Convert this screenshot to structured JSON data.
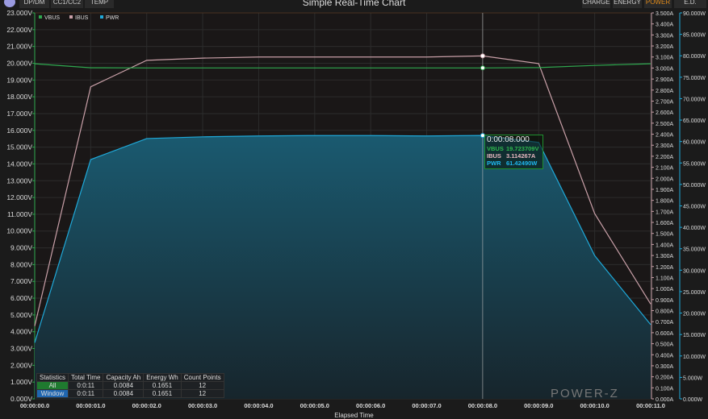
{
  "window": {
    "title": "Simple Real-Time Chart"
  },
  "tabs_left": [
    "DP/DM",
    "CC1/CC2",
    "TEMP"
  ],
  "tabs_right": [
    "CHARGE",
    "ENERGY",
    "POWER",
    "E.D."
  ],
  "active_tab": "POWER",
  "colors": {
    "vbus": "#2fa84f",
    "ibus": "#c9a0a8",
    "pwr": "#1fa8d8",
    "active_tab": "#e08a1a"
  },
  "legend": [
    "VBUS",
    "IBUS",
    "PWR"
  ],
  "tooltip": {
    "time": "0:00:08.000",
    "vbus_label": "VBUS",
    "vbus": "19.723709V",
    "ibus_label": "IBUS",
    "ibus": "3.114267A",
    "pwr_label": "PWR",
    "pwr": "61.42490W"
  },
  "stats": {
    "headers": [
      "Statistics",
      "Total Time",
      "Capacity Ah",
      "Energy Wh",
      "Count Points"
    ],
    "rows": [
      [
        "All",
        "0:0:11",
        "0.0084",
        "0.1651",
        "12"
      ],
      [
        "Window",
        "0:0:11",
        "0.0084",
        "0.1651",
        "12"
      ]
    ]
  },
  "watermark": "POWER-Z",
  "chart_data": {
    "type": "line",
    "title": "Simple Real-Time Chart",
    "xlabel": "Elapsed Time",
    "x": [
      0,
      1,
      2,
      3,
      4,
      5,
      6,
      7,
      8,
      9,
      10,
      11
    ],
    "xticks": [
      "00:00:00.0",
      "00:00:01.0",
      "00:00:02.0",
      "00:00:03.0",
      "00:00:04.0",
      "00:00:05.0",
      "00:00:06.0",
      "00:00:07.0",
      "00:00:08.0",
      "00:00:09.0",
      "00:00:10.0",
      "00:00:11.0"
    ],
    "axes": {
      "vbus": {
        "ylim": [
          0,
          23
        ],
        "unit": "V",
        "step": 1
      },
      "ibus": {
        "ylim": [
          0,
          3.5
        ],
        "unit": "A",
        "step": 0.1
      },
      "pwr": {
        "ylim": [
          0,
          90
        ],
        "unit": "W",
        "step": 5
      }
    },
    "series": [
      {
        "name": "VBUS",
        "axis": "vbus",
        "values": [
          19.97,
          19.73,
          19.72,
          19.72,
          19.72,
          19.72,
          19.72,
          19.72,
          19.72,
          19.74,
          19.87,
          19.97
        ]
      },
      {
        "name": "IBUS",
        "axis": "ibus",
        "values": [
          0.66,
          2.83,
          3.07,
          3.09,
          3.1,
          3.1,
          3.1,
          3.1,
          3.11,
          3.04,
          1.68,
          0.86
        ]
      },
      {
        "name": "PWR",
        "axis": "pwr",
        "values": [
          13.1,
          55.8,
          60.7,
          61.1,
          61.3,
          61.4,
          61.4,
          61.3,
          61.42,
          59.8,
          33.4,
          17.3
        ],
        "fill": true
      }
    ],
    "cursor_x": 8,
    "grid": true,
    "legend_position": "top-left"
  }
}
